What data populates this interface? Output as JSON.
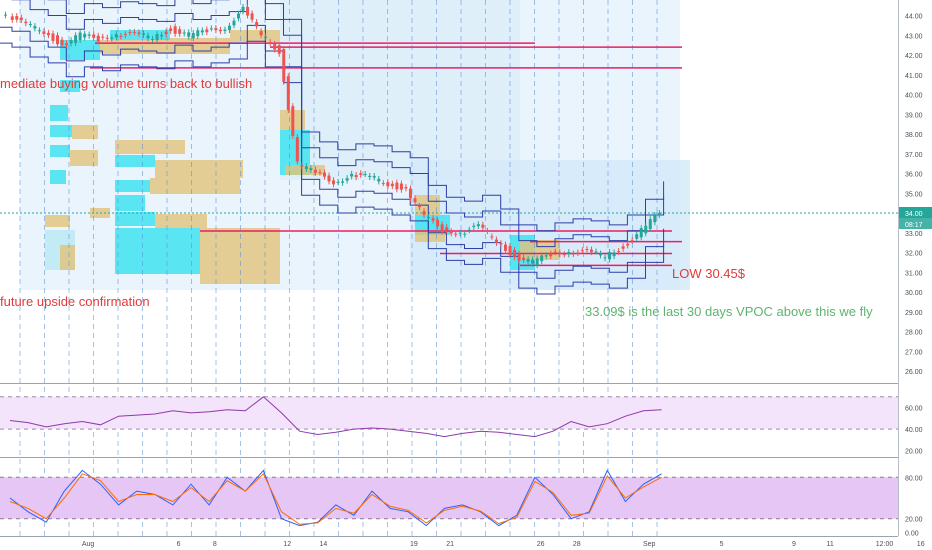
{
  "chart_data": {
    "type": "candlestick",
    "price_axis": {
      "ylim": [
        25.5,
        44.8
      ],
      "ticks": [
        "44.00",
        "43.00",
        "42.00",
        "41.00",
        "40.00",
        "39.00",
        "38.00",
        "37.00",
        "36.00",
        "35.00",
        "34.00",
        "33.00",
        "32.00",
        "31.00",
        "30.00",
        "29.00",
        "28.00",
        "27.00",
        "26.00"
      ],
      "tick_values": [
        44,
        43,
        42,
        41,
        40,
        39,
        38,
        37,
        36,
        35,
        34,
        33,
        32,
        31,
        30,
        29,
        28,
        27,
        26
      ],
      "last_price_label": "34.00",
      "countdown_label": "08:17",
      "last_price": 34.0
    },
    "rsi_axis": {
      "ylim": [
        15,
        80
      ],
      "ticks": [
        "60.00",
        "40.00",
        "20.00"
      ],
      "tick_values": [
        60,
        40,
        20
      ],
      "band": [
        40,
        70
      ]
    },
    "stoch_axis": {
      "ylim": [
        -5,
        105
      ],
      "ticks": [
        "80.00",
        "20.00",
        "0.00"
      ],
      "tick_values": [
        80,
        20,
        0
      ],
      "band": [
        20,
        80
      ]
    },
    "x_axis": {
      "ticks": [
        {
          "label": "Aug",
          "day": 1
        },
        {
          "label": "6",
          "day": 6
        },
        {
          "label": "8",
          "day": 8
        },
        {
          "label": "12",
          "day": 12
        },
        {
          "label": "14",
          "day": 14
        },
        {
          "label": "19",
          "day": 19
        },
        {
          "label": "21",
          "day": 21
        },
        {
          "label": "26",
          "day": 26
        },
        {
          "label": "28",
          "day": 28
        },
        {
          "label": "Sep",
          "day": 32
        },
        {
          "label": "5",
          "day": 36
        },
        {
          "label": "9",
          "day": 40
        },
        {
          "label": "11",
          "day": 42
        },
        {
          "label": "12:00",
          "day": 45
        },
        {
          "label": "16",
          "day": 47
        }
      ]
    },
    "horizontal_levels": [
      {
        "value": 42.6,
        "color": "#e91e63"
      },
      {
        "value": 42.4,
        "color": "#e91e63"
      },
      {
        "value": 41.35,
        "color": "#e91e63"
      },
      {
        "value": 33.09,
        "color": "#e91e63"
      },
      {
        "value": 32.55,
        "color": "#e91e63"
      },
      {
        "value": 31.95,
        "color": "#e91e63"
      },
      {
        "value": 31.35,
        "color": "#e91e63"
      }
    ],
    "price_path": [
      [
        -2,
        44.2
      ],
      [
        0,
        44.0
      ],
      [
        1,
        43.5
      ],
      [
        2,
        43.2
      ],
      [
        3,
        42.5
      ],
      [
        4,
        43.0
      ],
      [
        5,
        42.8
      ],
      [
        6,
        43.1
      ],
      [
        7,
        43.0
      ],
      [
        8,
        42.9
      ],
      [
        9,
        43.3
      ],
      [
        10,
        43.0
      ],
      [
        11,
        43.2
      ],
      [
        12,
        43.4
      ],
      [
        13,
        44.3
      ],
      [
        14,
        43.0
      ],
      [
        15,
        42.2
      ],
      [
        16,
        36.5
      ],
      [
        17,
        36.0
      ],
      [
        18,
        35.6
      ],
      [
        19,
        35.9
      ],
      [
        20,
        35.8
      ],
      [
        21,
        35.5
      ],
      [
        22,
        35.2
      ],
      [
        23,
        33.8
      ],
      [
        24,
        33.2
      ],
      [
        25,
        33.0
      ],
      [
        26,
        33.3
      ],
      [
        27,
        32.6
      ],
      [
        28,
        31.8
      ],
      [
        29,
        31.5
      ],
      [
        30,
        31.9
      ],
      [
        31,
        32.1
      ],
      [
        32,
        32.0
      ],
      [
        33,
        31.8
      ],
      [
        34,
        32.3
      ],
      [
        35,
        33.1
      ],
      [
        36,
        34.0
      ]
    ],
    "rsi": [
      48,
      46,
      42,
      45,
      47,
      44,
      52,
      53,
      54,
      57,
      55,
      56,
      58,
      57,
      70,
      55,
      38,
      35,
      37,
      40,
      41,
      40,
      38,
      36,
      33,
      36,
      38,
      37,
      35,
      33,
      38,
      47,
      42,
      45,
      52,
      57,
      58
    ],
    "stochastic_k": [
      50,
      30,
      15,
      60,
      90,
      70,
      40,
      60,
      55,
      40,
      70,
      40,
      80,
      60,
      90,
      20,
      10,
      15,
      40,
      25,
      60,
      35,
      30,
      10,
      35,
      40,
      30,
      10,
      25,
      80,
      55,
      20,
      30,
      90,
      45,
      70,
      85
    ],
    "stochastic_d": [
      45,
      35,
      20,
      50,
      85,
      75,
      45,
      55,
      55,
      45,
      65,
      45,
      75,
      60,
      85,
      30,
      12,
      14,
      35,
      28,
      55,
      38,
      32,
      14,
      32,
      38,
      31,
      13,
      22,
      74,
      58,
      25,
      28,
      82,
      50,
      66,
      80
    ],
    "annotations": [
      {
        "text": "mediate buying volume turns back to bullish",
        "color": "#e23a3a"
      },
      {
        "text": "future upside confirmation",
        "color": "#e23a3a"
      },
      {
        "text": "LOW 30.45$",
        "color": "#e23a3a"
      },
      {
        "text": "33.09$ is the last 30 days VPOC above this we fly",
        "color": "#5eb46e"
      }
    ]
  }
}
